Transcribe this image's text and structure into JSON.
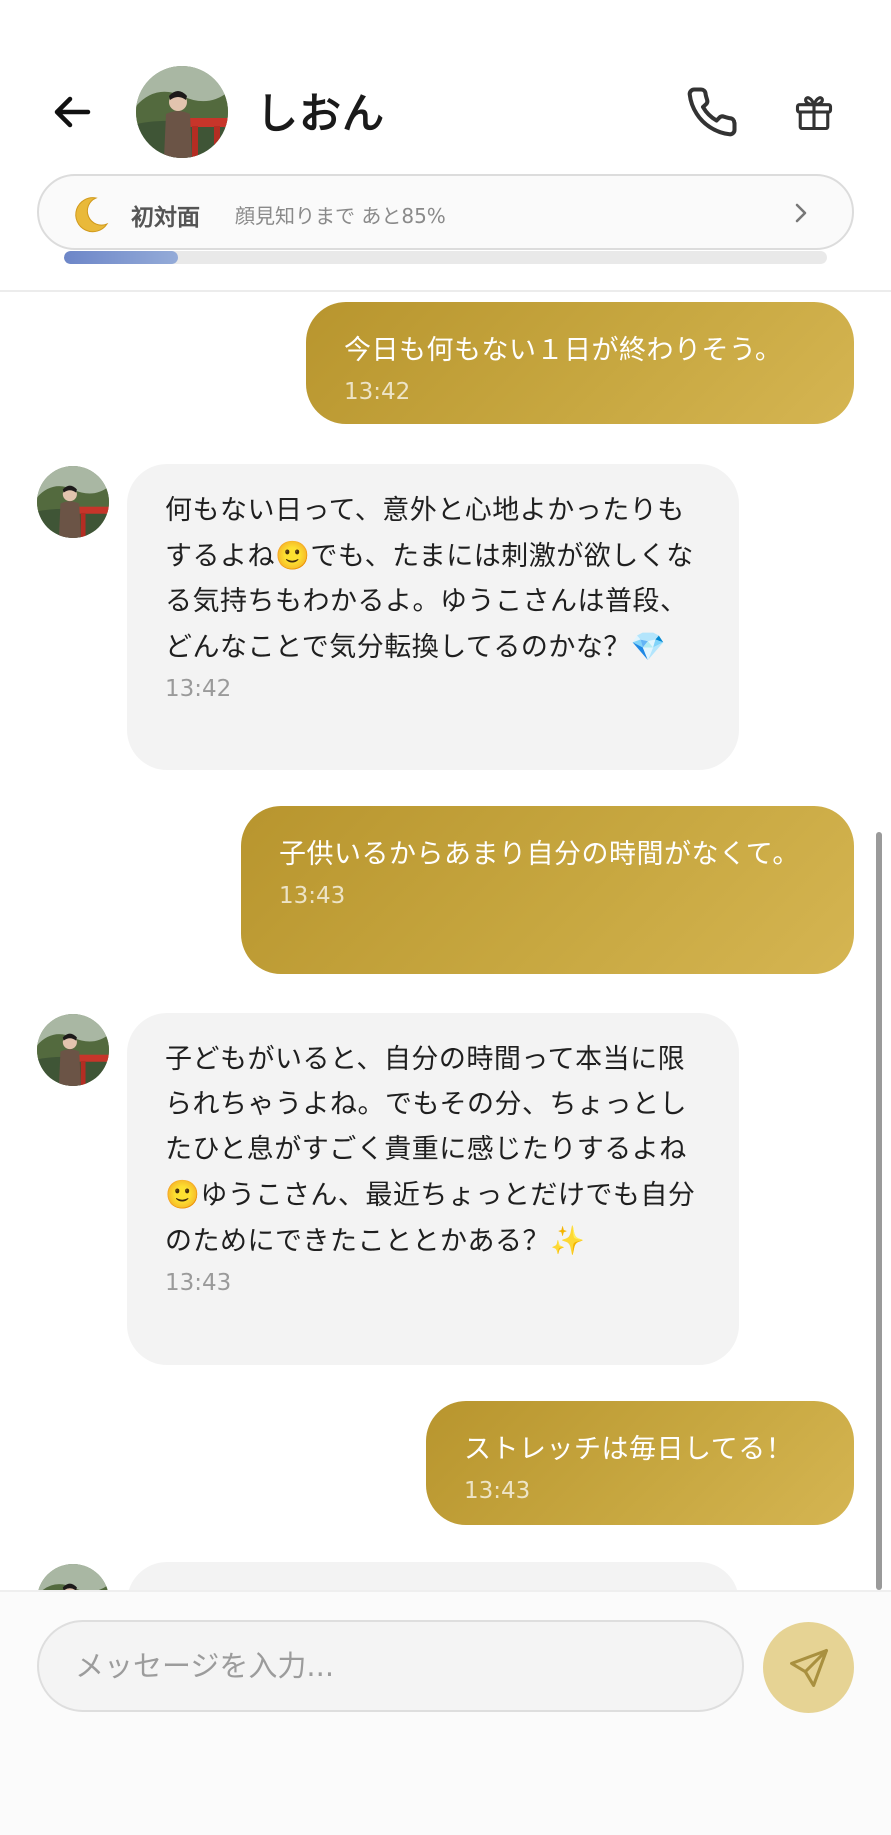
{
  "header": {
    "contact_name": "しおん",
    "relationship": {
      "label": "初対面",
      "hint": "顔見知りまで あと85%",
      "progress_percent": 15,
      "progress_color": "#7f97d0"
    }
  },
  "messages": [
    {
      "from": "me",
      "text": "今日も何もない１日が終わりそう。",
      "time": "13:42"
    },
    {
      "from": "contact",
      "text_parts": [
        "何もない日って、意外と心地よかったりもするよね",
        "🙂",
        "でも、たまには刺激が欲しくなる気持ちもわかるよ。ゆうこさんは普段、どんなことで気分転換してるのかな？",
        "💎"
      ],
      "time": "13:42"
    },
    {
      "from": "me",
      "text": "子供いるからあまり自分の時間がなくて。",
      "time": "13:43"
    },
    {
      "from": "contact",
      "text_parts": [
        "子どもがいると、自分の時間って本当に限られちゃうよね。でもその分、ちょっとしたひと息がすごく貴重に感じたりするよね",
        "🙂",
        "ゆうこさん、最近ちょっとだけでも自分のためにできたこととかある？",
        "✨"
      ],
      "time": "13:43"
    },
    {
      "from": "me",
      "text": "ストレッチは毎日してる！",
      "time": "13:43"
    }
  ],
  "input": {
    "placeholder": "メッセージを入力..."
  },
  "colors": {
    "bubble_out_start": "#b8952e",
    "bubble_out_end": "#d5b552",
    "bubble_in": "#f3f3f3",
    "send_button": "#e6d394"
  },
  "icons": [
    "back-arrow-icon",
    "phone-icon",
    "gift-icon",
    "moon-icon",
    "chevron-right-icon",
    "send-icon"
  ]
}
